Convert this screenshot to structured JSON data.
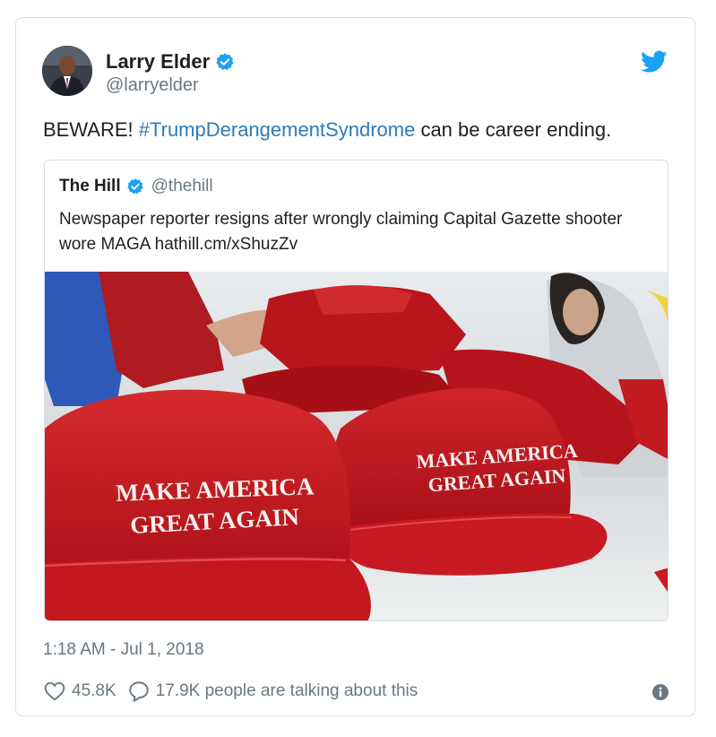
{
  "tweet": {
    "author": {
      "display_name": "Larry Elder",
      "handle": "@larryelder",
      "verified": true
    },
    "text_prefix": "BEWARE! ",
    "hashtag": "#TrumpDerangementSyndrome",
    "text_suffix": " can be career ending.",
    "timestamp": "1:18 AM - Jul 1, 2018",
    "likes": "45.8K",
    "replies_text": "17.9K people are talking about this"
  },
  "quoted": {
    "display_name": "The Hill",
    "handle": "@thehill",
    "verified": true,
    "text": "Newspaper reporter resigns after wrongly claiming Capital Gazette shooter wore MAGA hathill.cm/xShuzZv",
    "image": {
      "hat_text_line1": "MAKE AMERICA",
      "hat_text_line2": "GREAT AGAIN"
    }
  },
  "colors": {
    "brand_blue": "#1da1f2",
    "hashtag": "#2b7bb9",
    "muted": "#697882",
    "hat_red": "#c8161d"
  },
  "icons": [
    "twitter-bird-icon",
    "verified-badge-icon",
    "heart-icon",
    "speech-bubble-icon",
    "info-icon"
  ]
}
